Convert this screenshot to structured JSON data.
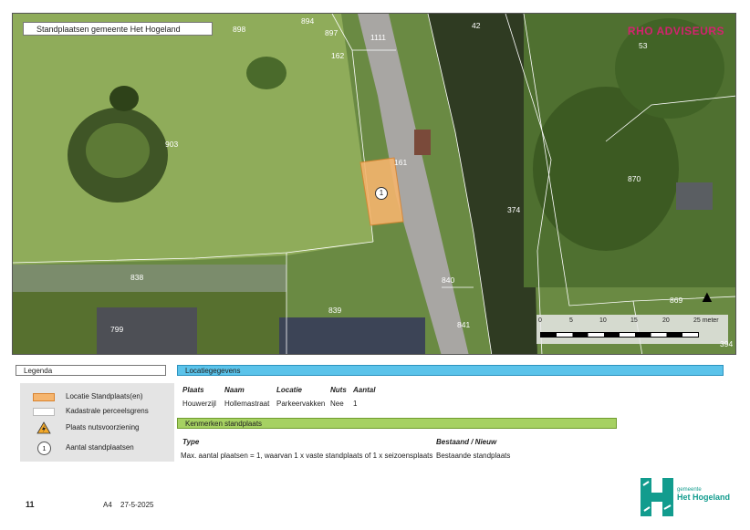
{
  "map": {
    "title": "Standplaatsen gemeente Het Hogeland",
    "brand": "RHO ADVISEURS",
    "parcels": [
      "898",
      "894",
      "897",
      "1111",
      "42",
      "53",
      "162",
      "903",
      "161",
      "870",
      "374",
      "838",
      "840",
      "839",
      "841",
      "799",
      "869",
      "394"
    ],
    "marker_label": "1",
    "scale": {
      "labels": [
        "0",
        "5",
        "10",
        "15",
        "20",
        "25 meter"
      ]
    },
    "north_symbol": "▲"
  },
  "legend": {
    "title": "Legenda",
    "items": [
      {
        "label": "Locatie Standplaats(en)",
        "icon": "orange-fill-swatch",
        "color": "#f5b56e"
      },
      {
        "label": "Kadastrale perceelsgrens",
        "icon": "white-outline-swatch"
      },
      {
        "label": "Plaats nutsvoorziening",
        "icon": "warning-icon",
        "color": "#f2a82a"
      },
      {
        "label": "Aantal standplaatsen",
        "icon": "number-circle-icon",
        "symbol": "1"
      }
    ]
  },
  "locatie": {
    "title": "Locatiegegevens",
    "headers": [
      "Plaats",
      "Naam",
      "Locatie",
      "Nuts",
      "Aantal"
    ],
    "row": [
      "Houwerzijl",
      "Hollemastraat",
      "Parkeervakken",
      "Nee",
      "1"
    ]
  },
  "kenmerken": {
    "title": "Kenmerken standplaats",
    "headers": [
      "Type",
      "Bestaand / Nieuw"
    ],
    "row": [
      "Max. aantal plaatsen = 1, waarvan 1 x vaste standplaats of 1 x seizoensplaats",
      "Bestaande standplaats"
    ]
  },
  "footer": {
    "page": "11",
    "paper": "A4",
    "date": "27-5-2025",
    "logo_line1": "gemeente",
    "logo_line2": "Het Hogeland"
  },
  "colors": {
    "blue_header": "#5bc3ea",
    "green_header": "#a6d162",
    "brand": "#d2236e",
    "logo": "#129c8e"
  }
}
